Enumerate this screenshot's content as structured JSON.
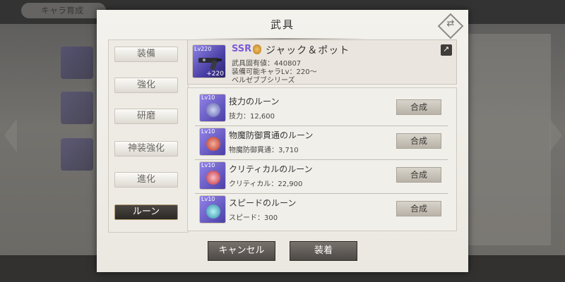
{
  "background": {
    "tab_label": "キャラ育成"
  },
  "dialog": {
    "title": "武具",
    "corner_icon": "swap-diamond-icon"
  },
  "menu": {
    "items": [
      {
        "label": "装備",
        "active": false
      },
      {
        "label": "強化",
        "active": false
      },
      {
        "label": "研磨",
        "active": false
      },
      {
        "label": "神装強化",
        "active": false
      },
      {
        "label": "進化",
        "active": false
      },
      {
        "label": "ルーン",
        "active": true
      }
    ]
  },
  "weapon": {
    "level": "Lv220",
    "plus": "+220",
    "rarity": "SSR",
    "name": "ジャック＆ポット",
    "id_line": "武具固有値：440807",
    "level_line": "装備可能キャラLv：220～",
    "series_line": "ベルゼブブシリーズ",
    "type_icon": "gun-icon"
  },
  "runes": [
    {
      "level": "Lv10",
      "name": "技力のルーン",
      "stat": "技力：12,600",
      "button": "合成",
      "gem_color": "#5a5fa8"
    },
    {
      "level": "Lv10",
      "name": "物魔防御貫通のルーン",
      "stat": "物魔防御貫通：3,710",
      "button": "合成",
      "gem_color": "#b8332a"
    },
    {
      "level": "Lv10",
      "name": "クリティカルのルーン",
      "stat": "クリティカル：22,900",
      "button": "合成",
      "gem_color": "#c02a3a"
    },
    {
      "level": "Lv10",
      "name": "スピードのルーン",
      "stat": "スピード：300",
      "button": "合成",
      "gem_color": "#2f8fa8"
    }
  ],
  "buttons": {
    "cancel": "キャンセル",
    "equip": "装着"
  }
}
